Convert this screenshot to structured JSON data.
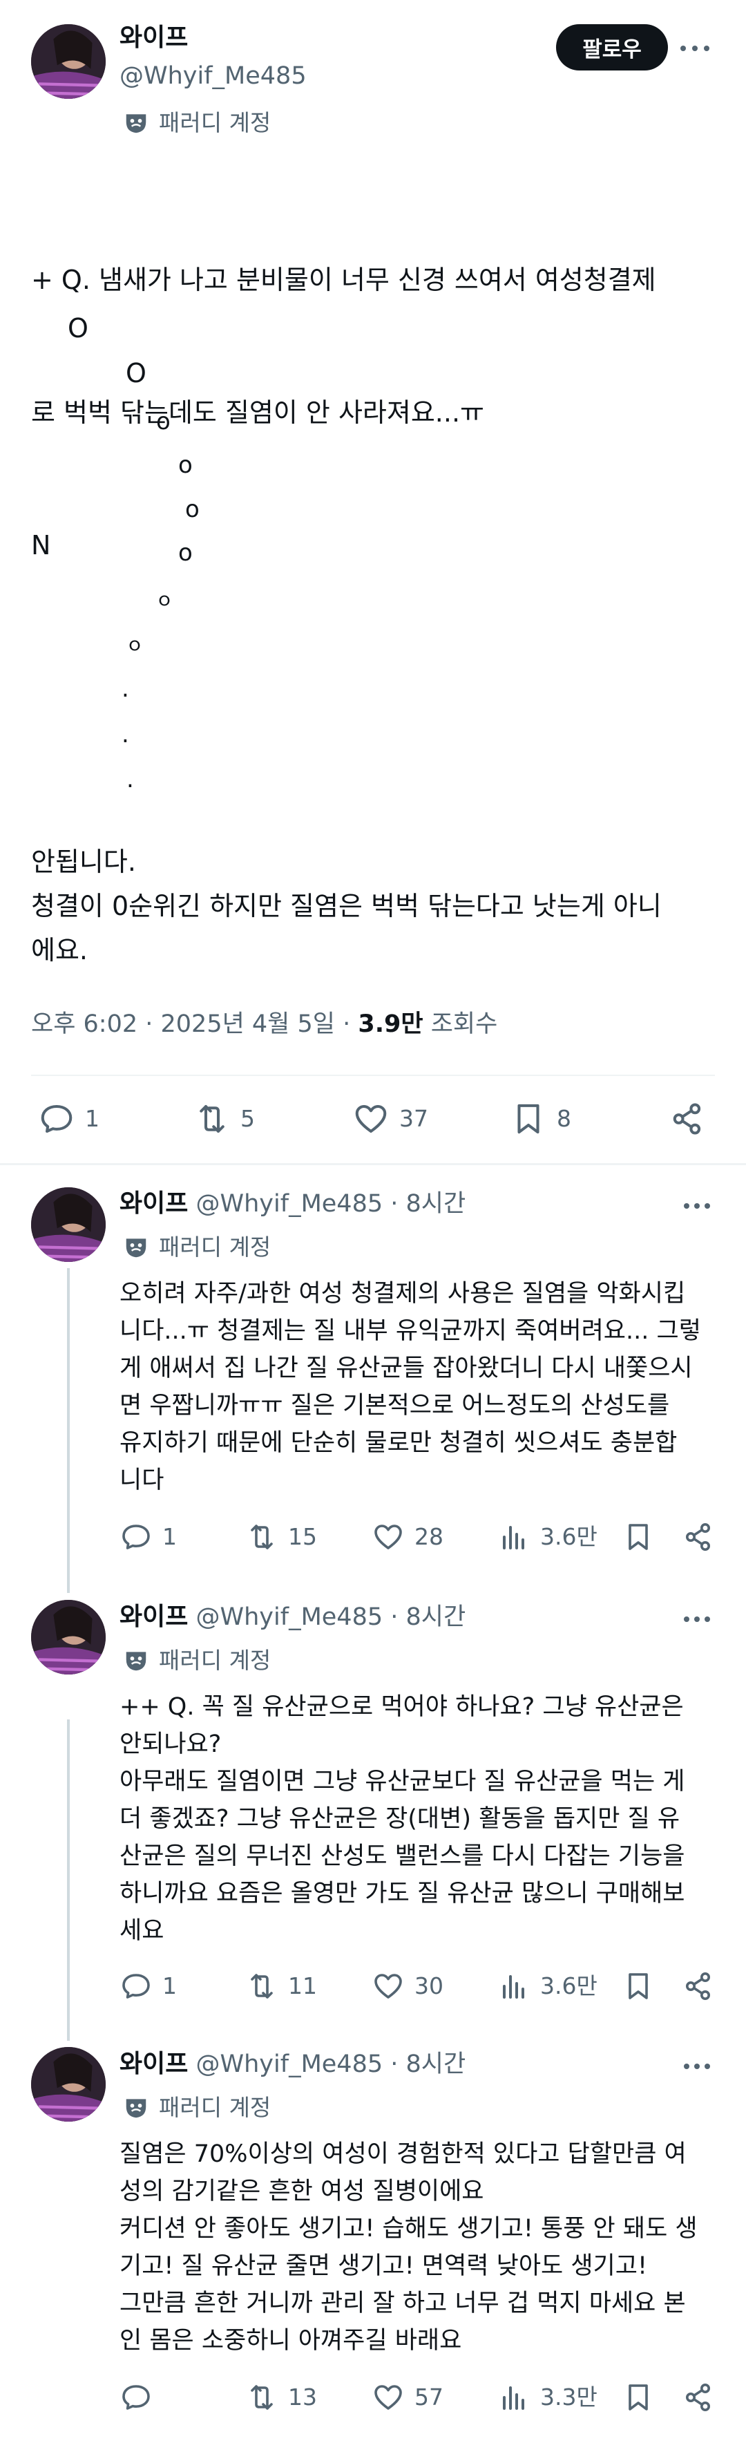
{
  "main_post": {
    "author_name": "와이프",
    "handle": "@Whyif_Me485",
    "parody_label": "패러디 계정",
    "follow_label": "팔로우",
    "text_lines": [
      "+ Q. 냄새가 나고 분비물이 너무 신경 쓰여서 여성청결제",
      "로 벅벅 닦는데도 질염이 안 사라져요...ㅠ",
      "N"
    ],
    "o_sequence": [
      "O",
      "O",
      "o",
      "o",
      "o",
      "o",
      "ｏ",
      "ｏ",
      ".",
      ".",
      "."
    ],
    "answer_lines": [
      "안됩니다.",
      "청결이 0순위긴 하지만 질염은 벅벅 닦는다고 낫는게 아니",
      "에요."
    ],
    "time": "오후 6:02",
    "date": "2025년 4월 5일",
    "views_value": "3.9만",
    "views_label": "조회수",
    "replies": "1",
    "reposts": "5",
    "likes": "37",
    "bookmarks": "8"
  },
  "replies": [
    {
      "author_name": "와이프",
      "handle": "@Whyif_Me485",
      "time_ago": "8시간",
      "parody_label": "패러디 계정",
      "text_lines": [
        "오히려 자주/과한 여성 청결제의 사용은 질염을 악화시킵",
        "니다...ㅠ 청결제는 질 내부 유익균까지 죽여버려요... 그렇",
        "게 애써서 집 나간 질 유산균들 잡아왔더니 다시 내쫓으시",
        "면 우짭니까ㅠㅠ 질은 기본적으로 어느정도의 산성도를",
        "유지하기 때문에 단순히 물로만 청결히 씻으셔도 충분합",
        "니다"
      ],
      "replies": "1",
      "reposts": "15",
      "likes": "28",
      "views": "3.6만"
    },
    {
      "author_name": "와이프",
      "handle": "@Whyif_Me485",
      "time_ago": "8시간",
      "parody_label": "패러디 계정",
      "text_lines": [
        "++ Q. 꼭 질 유산균으로 먹어야 하나요? 그냥 유산균은",
        "안되나요?",
        "아무래도 질염이면 그냥 유산균보다 질 유산균을 먹는 게",
        "더 좋겠죠? 그냥 유산균은 장(대변) 활동을 돕지만 질 유",
        "산균은 질의 무너진 산성도 밸런스를 다시 다잡는 기능을",
        "하니까요 요즘은 올영만 가도 질 유산균 많으니 구매해보",
        "세요"
      ],
      "replies": "1",
      "reposts": "11",
      "likes": "30",
      "views": "3.6만"
    },
    {
      "author_name": "와이프",
      "handle": "@Whyif_Me485",
      "time_ago": "8시간",
      "parody_label": "패러디 계정",
      "text_lines": [
        "질염은 70%이상의 여성이 경험한적 있다고 답할만큼 여",
        "성의 감기같은 흔한 여성 질병이에요",
        "커디션 안 좋아도 생기고! 습해도 생기고! 통풍 안 돼도 생",
        "기고! 질 유산균 줄면 생기고! 면역력 낮아도 생기고!",
        "그만큼 흔한 거니까 관리 잘 하고 너무 겁 먹지 마세요 본",
        "인 몸은 소중하니 아껴주길 바래요"
      ],
      "replies": "",
      "reposts": "13",
      "likes": "57",
      "views": "3.3만"
    }
  ]
}
